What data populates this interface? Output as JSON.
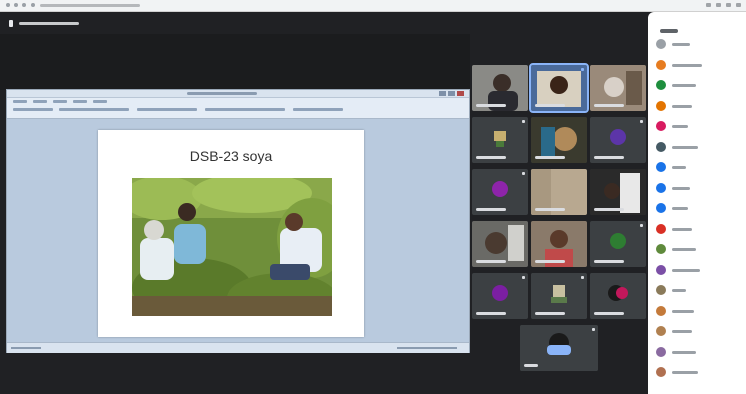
{
  "browser": {
    "url": ""
  },
  "meeting": {
    "title": ""
  },
  "presentation": {
    "window_title": "",
    "slide_title": "DSB-23 soya",
    "slide_image": "soybean-field-photo"
  },
  "participants": [
    {
      "name": "",
      "type": "video"
    },
    {
      "name": "",
      "type": "video",
      "highlighted": true
    },
    {
      "name": "",
      "type": "video"
    },
    {
      "name": "",
      "type": "video"
    },
    {
      "name": "",
      "type": "video"
    },
    {
      "name": "",
      "type": "avatar",
      "color": "#5c35a8"
    },
    {
      "name": "",
      "type": "avatar",
      "color": "#8e24aa"
    },
    {
      "name": "",
      "type": "video"
    },
    {
      "name": "",
      "type": "video"
    },
    {
      "name": "",
      "type": "video"
    },
    {
      "name": "",
      "type": "video"
    },
    {
      "name": "",
      "type": "avatar",
      "color": "#2e7d32"
    },
    {
      "name": "",
      "type": "avatar",
      "color": "#7b1fa2"
    },
    {
      "name": "",
      "type": "video"
    },
    {
      "name": "",
      "type": "avatar",
      "color": "#c2185b"
    },
    {
      "name": "",
      "type": "video"
    }
  ],
  "people_panel": {
    "title": "",
    "avatar_colors": [
      "#9aa0a6",
      "#e67c20",
      "#1e8e3e",
      "#e37400",
      "#d81b60",
      "#455a64",
      "#1a73e8",
      "#1a73e8",
      "#1a73e8",
      "#d93025",
      "#5f8a3c",
      "#7b4fa6",
      "#8a7a5a",
      "#c47a3a",
      "#b08050",
      "#8a6aa0",
      "#b07050"
    ]
  }
}
